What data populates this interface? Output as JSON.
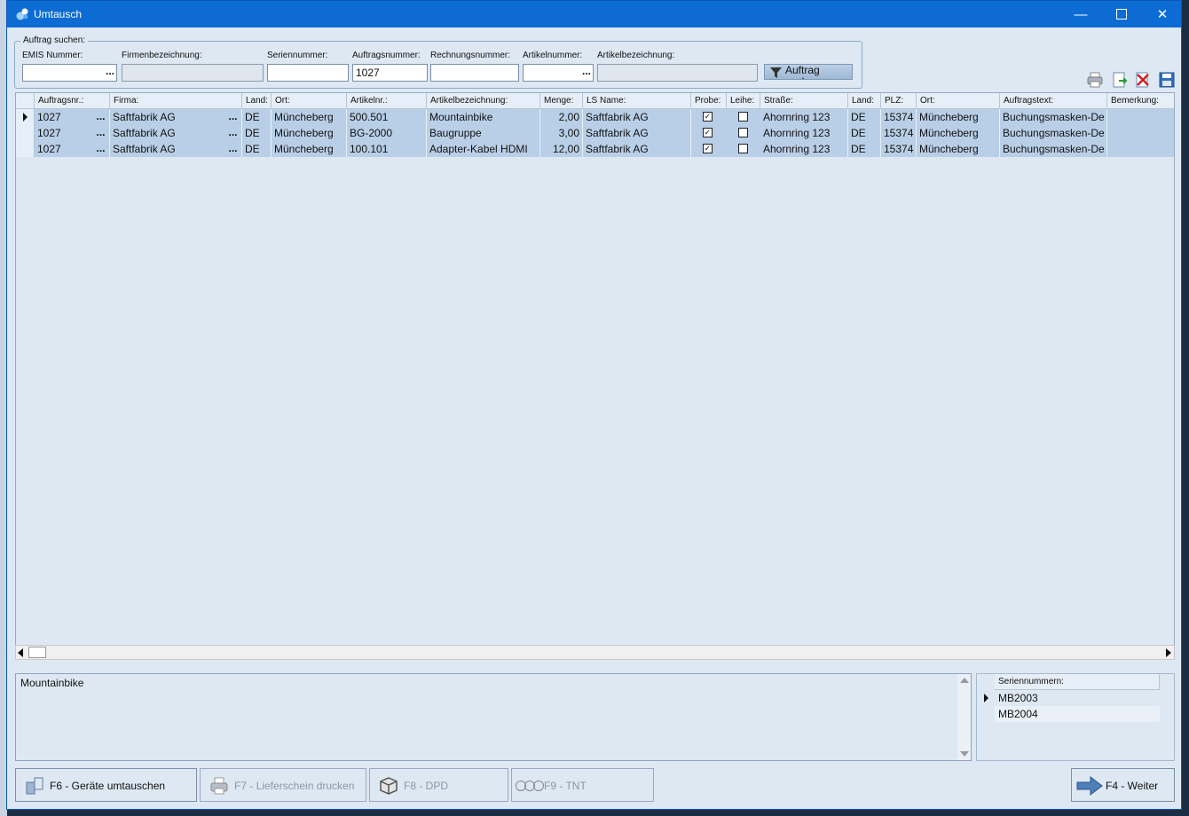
{
  "window": {
    "title": "Umtausch"
  },
  "search": {
    "group_label": "Auftrag suchen:",
    "labels": {
      "emis": "EMIS Nummer:",
      "firma": "Firmenbezeichnung:",
      "serien": "Seriennummer:",
      "auftrag": "Auftragsnummer:",
      "rechnung": "Rechnungsnummer:",
      "artikelnr": "Artikelnummer:",
      "artikelbez": "Artikelbezeichnung:"
    },
    "values": {
      "emis": "",
      "firma": "",
      "serien": "",
      "auftrag": "1027",
      "rechnung": "",
      "artikelnr": "",
      "artikelbez": ""
    },
    "button_label": "Auftrag suchen"
  },
  "toolbar_icons": [
    "print-icon",
    "export-icon",
    "delete-icon",
    "save-icon"
  ],
  "grid": {
    "columns": [
      "Auftragsnr.:",
      "Firma:",
      "Land:",
      "Ort:",
      "Artikelnr.:",
      "Artikelbezeichnung:",
      "Menge:",
      "LS Name:",
      "Probe:",
      "Leihe:",
      "Straße:",
      "Land:",
      "PLZ:",
      "Ort:",
      "Auftragstext:",
      "Bemerkung:"
    ],
    "rows": [
      {
        "auftragsnr": "1027",
        "firma": "Saftfabrik AG",
        "land": "DE",
        "ort": "Müncheberg",
        "artikelnr": "500.501",
        "artikelbez": "Mountainbike",
        "menge": "2,00",
        "ls_name": "Saftfabrik AG",
        "probe": true,
        "leihe": false,
        "strasse": "Ahornring 123",
        "land2": "DE",
        "plz": "15374",
        "ort2": "Müncheberg",
        "auftragstext": "Buchungsmasken-De",
        "bemerkung": ""
      },
      {
        "auftragsnr": "1027",
        "firma": "Saftfabrik AG",
        "land": "DE",
        "ort": "Müncheberg",
        "artikelnr": "BG-2000",
        "artikelbez": "Baugruppe",
        "menge": "3,00",
        "ls_name": "Saftfabrik AG",
        "probe": true,
        "leihe": false,
        "strasse": "Ahornring 123",
        "land2": "DE",
        "plz": "15374",
        "ort2": "Müncheberg",
        "auftragstext": "Buchungsmasken-De",
        "bemerkung": ""
      },
      {
        "auftragsnr": "1027",
        "firma": "Saftfabrik AG",
        "land": "DE",
        "ort": "Müncheberg",
        "artikelnr": "100.101",
        "artikelbez": "Adapter-Kabel HDMI",
        "menge": "12,00",
        "ls_name": "Saftfabrik AG",
        "probe": true,
        "leihe": false,
        "strasse": "Ahornring 123",
        "land2": "DE",
        "plz": "15374",
        "ort2": "Müncheberg",
        "auftragstext": "Buchungsmasken-De",
        "bemerkung": ""
      }
    ],
    "ellipsis": "..."
  },
  "memo": {
    "text": "Mountainbike"
  },
  "serials": {
    "header": "Seriennummern:",
    "items": [
      "MB2003",
      "MB2004"
    ]
  },
  "footer": {
    "f6": "F6 - Geräte umtauschen",
    "f7": "F7 - Lieferschein drucken",
    "f8": "F8 - DPD",
    "f9": "F9 - TNT",
    "f4": "F4 - Weiter"
  },
  "colors": {
    "titlebar": "#0c6cd4",
    "window_bg": "#dde8f3",
    "row_selected": "#b9cfe7"
  }
}
